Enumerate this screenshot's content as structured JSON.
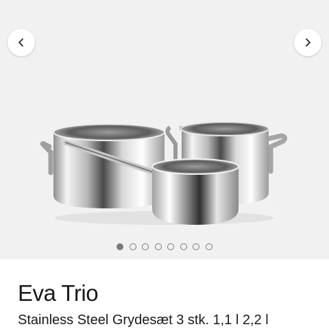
{
  "gallery": {
    "image_alt": "Eva Trio Stainless Steel Grydesæt 3 stk.",
    "prev_icon": "chevron-left-icon",
    "next_icon": "chevron-right-icon",
    "slide_count": 8,
    "active_slide": 1
  },
  "product": {
    "title": "Eva Trio",
    "subtitle": "Stainless Steel Grydesæt 3 stk. 1,1 l 2,2 l"
  },
  "colors": {
    "gallery_bg": "#f1f1f1",
    "text": "#1a1a1a",
    "dot": "#7a7a7a"
  }
}
